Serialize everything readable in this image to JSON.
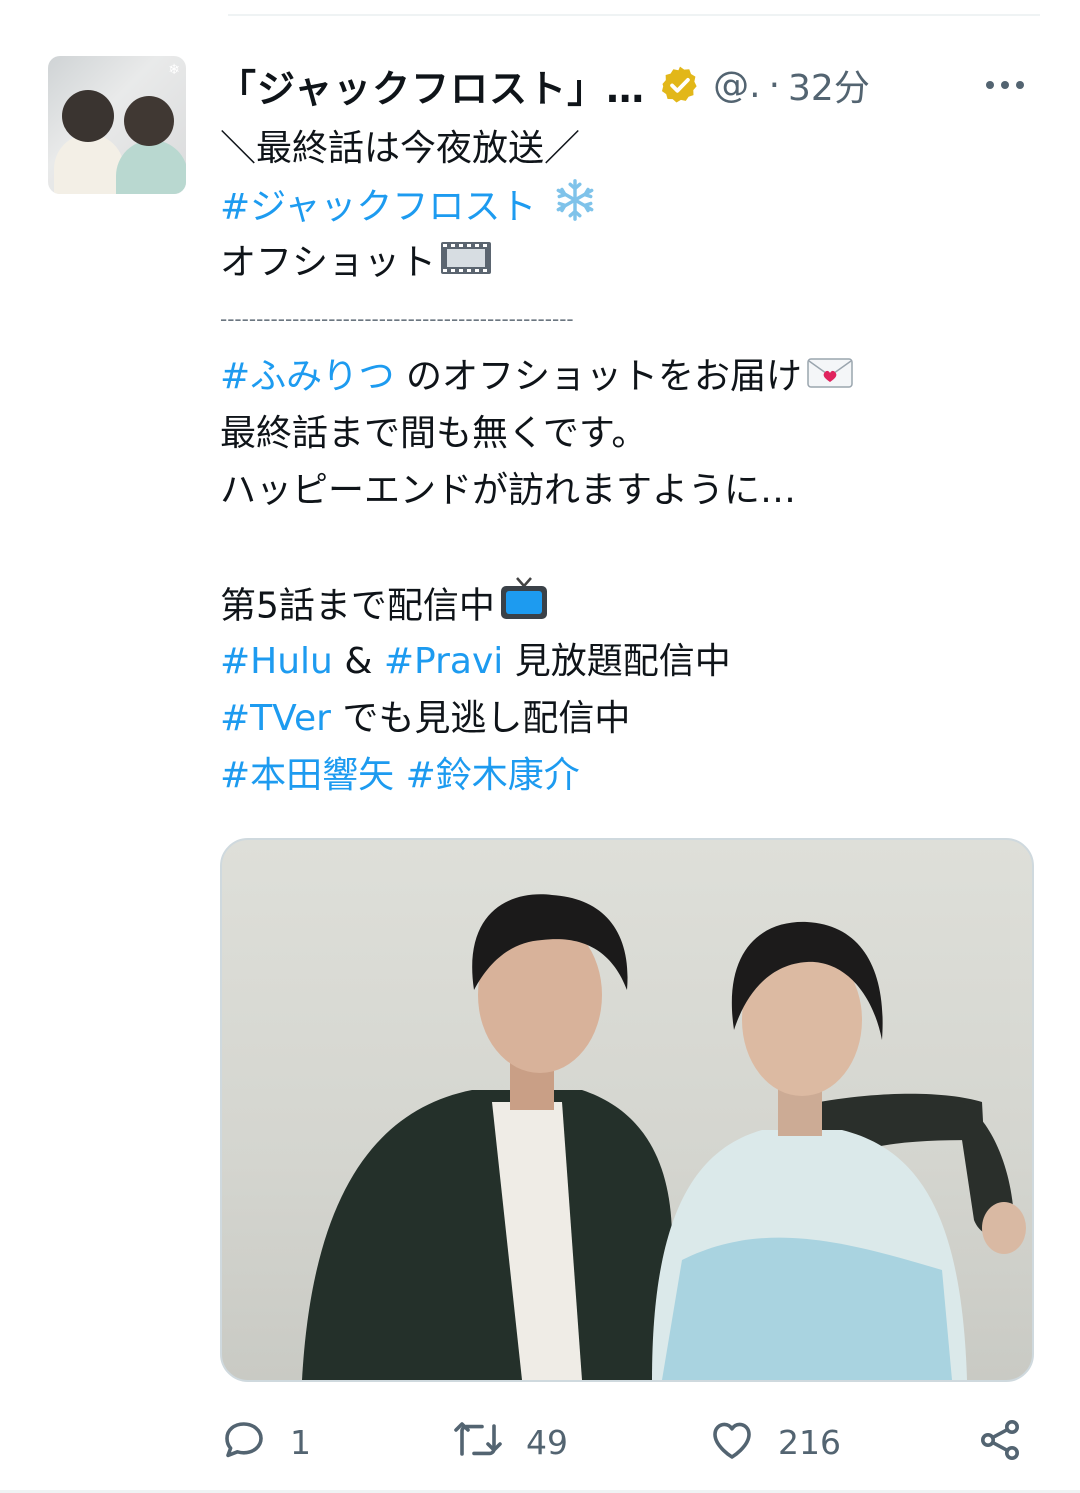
{
  "tweet": {
    "author_name": "「ジャックフロスト」…",
    "handle": "@.",
    "separator": "·",
    "time": "32分",
    "lines": {
      "l1": "＼最終話は今夜放送／",
      "l2_tag": "#ジャックフロスト",
      "l3": "オフショット",
      "l4": "-------------------------------------------------",
      "l5_tag": "#ふみりつ",
      "l5_text": "のオフショットをお届け",
      "l6": "最終話まで間も無くです。",
      "l7": "ハッピーエンドが訪れますように…",
      "l8": "第5話まで配信中",
      "l9_tag1": "#Hulu",
      "l9_amp": "&",
      "l9_tag2": "#Pravi",
      "l9_text": "見放題配信中",
      "l10_tag": "#TVer",
      "l10_text": "でも見逃し配信中",
      "l11_tag1": "#本田響矢",
      "l11_tag2": "#鈴木康介"
    },
    "emoji": {
      "snowflake": "snowflake-icon",
      "film": "film-frames-icon",
      "letter": "love-letter-icon",
      "tv": "television-icon"
    },
    "actions": {
      "replies": "1",
      "retweets": "49",
      "likes": "216"
    }
  },
  "colors": {
    "link": "#1d9bf0",
    "secondary": "#536471",
    "verified": "#e2b719"
  }
}
